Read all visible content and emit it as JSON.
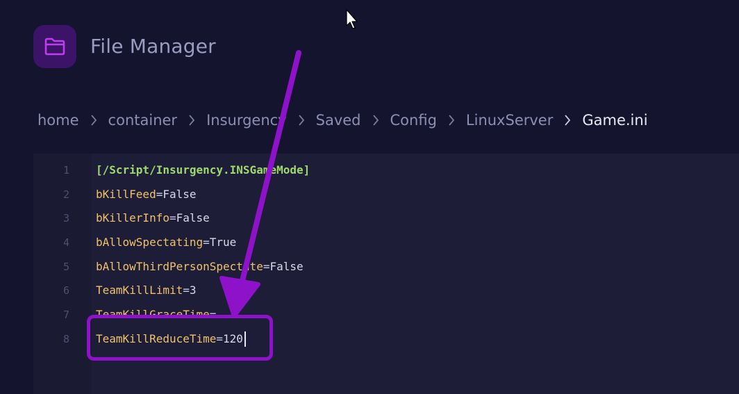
{
  "app": {
    "title": "File Manager",
    "icon": "folder-icon",
    "accent": "#3b1468"
  },
  "breadcrumb": [
    {
      "label": "home"
    },
    {
      "label": "container"
    },
    {
      "label": "Insurgency"
    },
    {
      "label": "Saved"
    },
    {
      "label": "Config"
    },
    {
      "label": "LinuxServer"
    },
    {
      "label": "Game.ini",
      "current": true
    }
  ],
  "editor": {
    "lines": [
      {
        "num": "1",
        "section": "[/Script/Insurgency.INSGameMode]"
      },
      {
        "num": "2",
        "key": "bKillFeed",
        "eq": "=",
        "value": "False"
      },
      {
        "num": "3",
        "key": "bKillerInfo",
        "eq": "=",
        "value": "False"
      },
      {
        "num": "4",
        "key": "bAllowSpectating",
        "eq": "=",
        "value": "True"
      },
      {
        "num": "5",
        "key": "bAllowThirdPersonSpectate",
        "eq": "=",
        "value": "False"
      },
      {
        "num": "6",
        "key": "TeamKillLimit",
        "eq": "=",
        "value": "3"
      },
      {
        "num": "7",
        "key": "TeamKillGraceTime",
        "eq": "=",
        "value": ""
      },
      {
        "num": "8",
        "key": "TeamKillReduceTime",
        "eq": "=",
        "value": "120"
      }
    ],
    "colors": {
      "section": "#9fd86c",
      "key": "#f0c36a",
      "annotation": "#8d12c9"
    }
  }
}
